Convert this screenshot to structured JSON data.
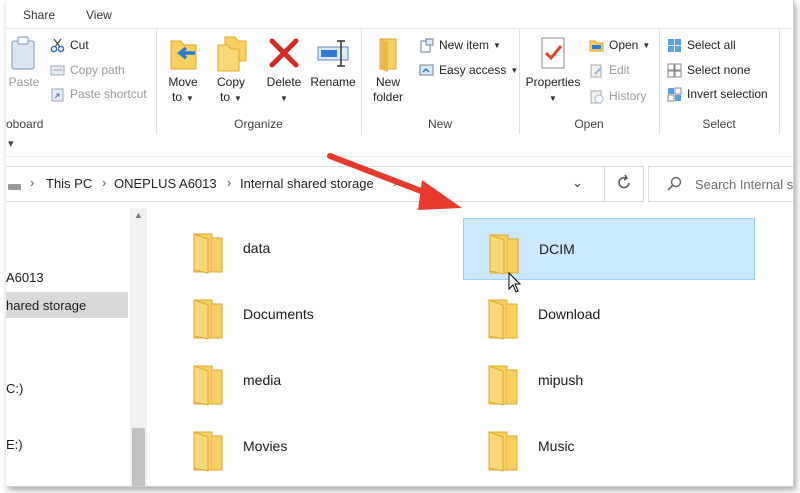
{
  "tabs": [
    "Share",
    "View"
  ],
  "ribbon": {
    "clipboard": {
      "paste_label": "Paste",
      "cut_label": "Cut",
      "copy_path_label": "Copy path",
      "paste_shortcut_label": "Paste shortcut",
      "group_label": "oboard"
    },
    "organize": {
      "move_to_label": "Move",
      "move_to_sub": "to",
      "copy_to_label": "Copy",
      "copy_to_sub": "to",
      "delete_label": "Delete",
      "rename_label": "Rename",
      "group_label": "Organize"
    },
    "new": {
      "new_folder_label": "New",
      "new_folder_sub": "folder",
      "new_item_label": "New item",
      "easy_access_label": "Easy access",
      "group_label": "New"
    },
    "open": {
      "properties_label": "Properties",
      "open_label": "Open",
      "edit_label": "Edit",
      "history_label": "History",
      "group_label": "Open"
    },
    "select": {
      "select_all_label": "Select all",
      "select_none_label": "Select none",
      "invert_label": "Invert selection",
      "group_label": "Select"
    }
  },
  "address": {
    "crumbs": [
      "This PC",
      "ONEPLUS A6013",
      "Internal shared storage"
    ],
    "search_placeholder": "Search Internal s"
  },
  "nav": {
    "items": [
      "A6013",
      "hared storage",
      "C:)",
      "E:)"
    ]
  },
  "files": [
    {
      "name": "data",
      "selected": false
    },
    {
      "name": "DCIM",
      "selected": true
    },
    {
      "name": "Documents",
      "selected": false
    },
    {
      "name": "Download",
      "selected": false
    },
    {
      "name": "media",
      "selected": false
    },
    {
      "name": "mipush",
      "selected": false
    },
    {
      "name": "Movies",
      "selected": false
    },
    {
      "name": "Music",
      "selected": false
    }
  ],
  "colors": {
    "selection_bg": "#cce8ff",
    "selection_border": "#99d1ff",
    "folder_yellow": "#f6cf5f",
    "arrow_red": "#e8392f"
  }
}
